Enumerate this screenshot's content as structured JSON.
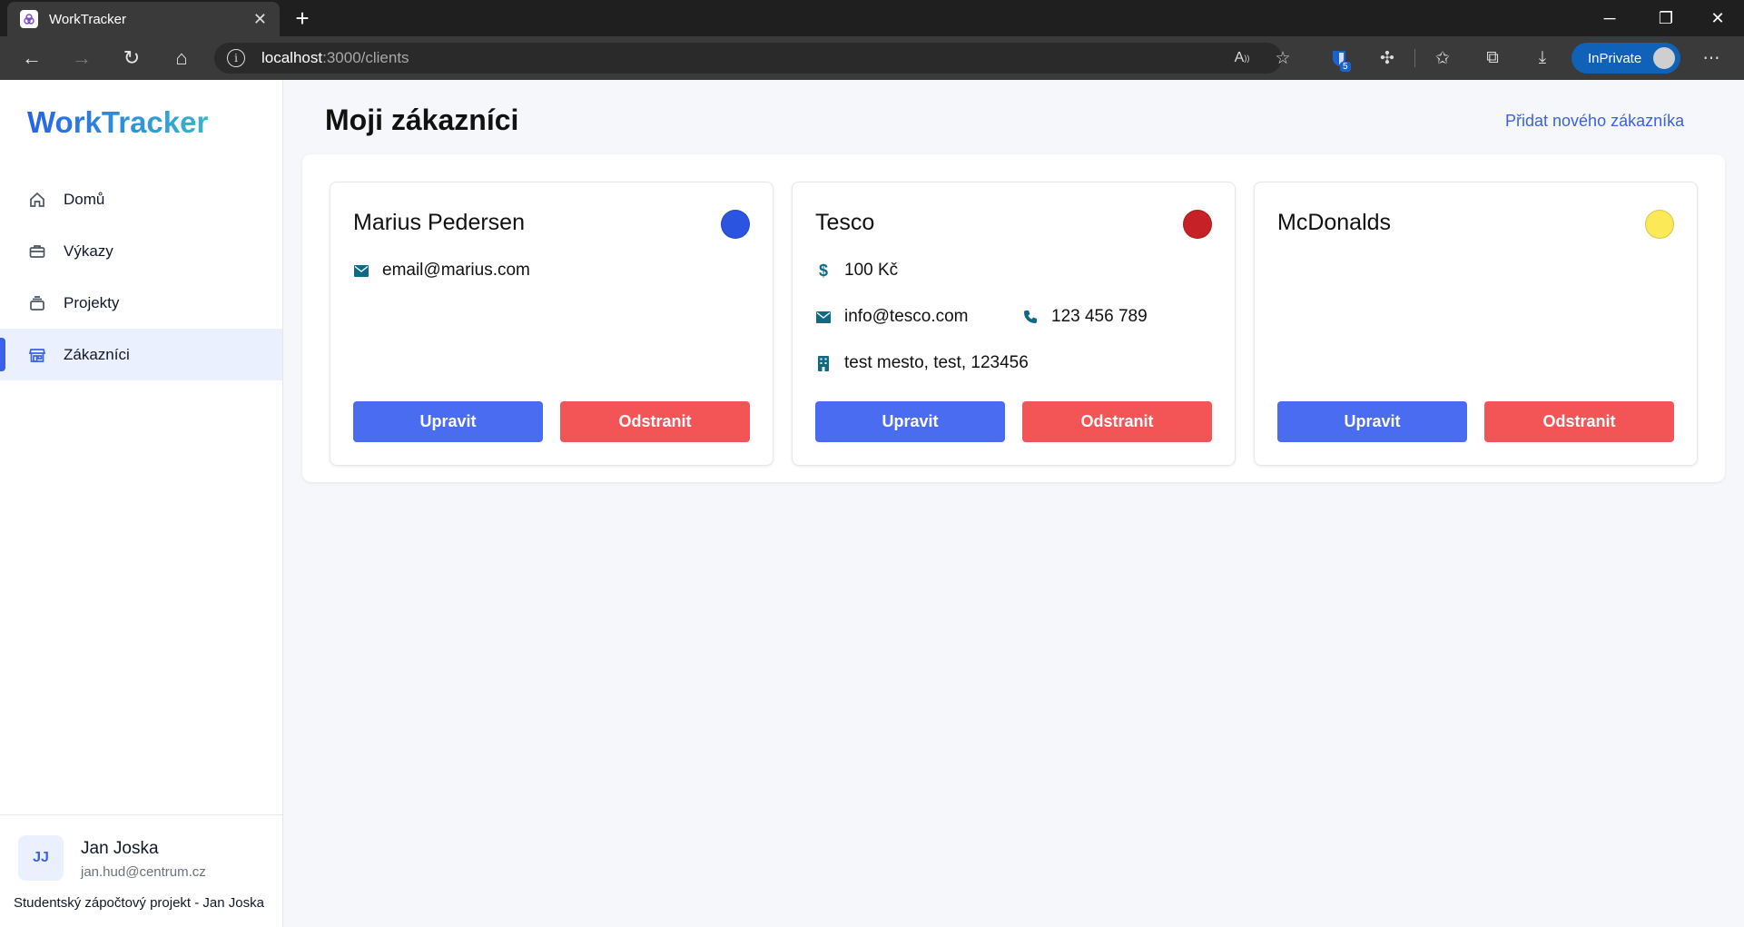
{
  "browser": {
    "tab_title": "WorkTracker",
    "url_host": "localhost",
    "url_path": ":3000/clients",
    "inprivate_label": "InPrivate",
    "extension_badge": "5"
  },
  "app": {
    "logo": "WorkTracker",
    "nav": [
      {
        "label": "Domů",
        "icon": "home-icon"
      },
      {
        "label": "Výkazy",
        "icon": "briefcase-icon"
      },
      {
        "label": "Projekty",
        "icon": "stack-icon"
      },
      {
        "label": "Zákazníci",
        "icon": "storefront-icon",
        "active": true
      }
    ],
    "user": {
      "initials": "JJ",
      "name": "Jan Joska",
      "email": "jan.hud@centrum.cz"
    },
    "footer_note": "Studentský zápočtový projekt - Jan Joska"
  },
  "main": {
    "title": "Moji zákazníci",
    "add_link": "Přidat nového zákazníka",
    "edit_label": "Upravit",
    "delete_label": "Odstranit",
    "clients": [
      {
        "name": "Marius Pedersen",
        "color": "#2b55e0",
        "email": "email@marius.com"
      },
      {
        "name": "Tesco",
        "color": "#c62126",
        "price": "100 Kč",
        "email": "info@tesco.com",
        "phone": "123 456 789",
        "address": "test mesto, test, 123456"
      },
      {
        "name": "McDonalds",
        "color": "#fbe958"
      }
    ]
  },
  "colors": {
    "accent": "#3b62e6",
    "edit_button": "#4a6cf0",
    "delete_button": "#f35456"
  }
}
